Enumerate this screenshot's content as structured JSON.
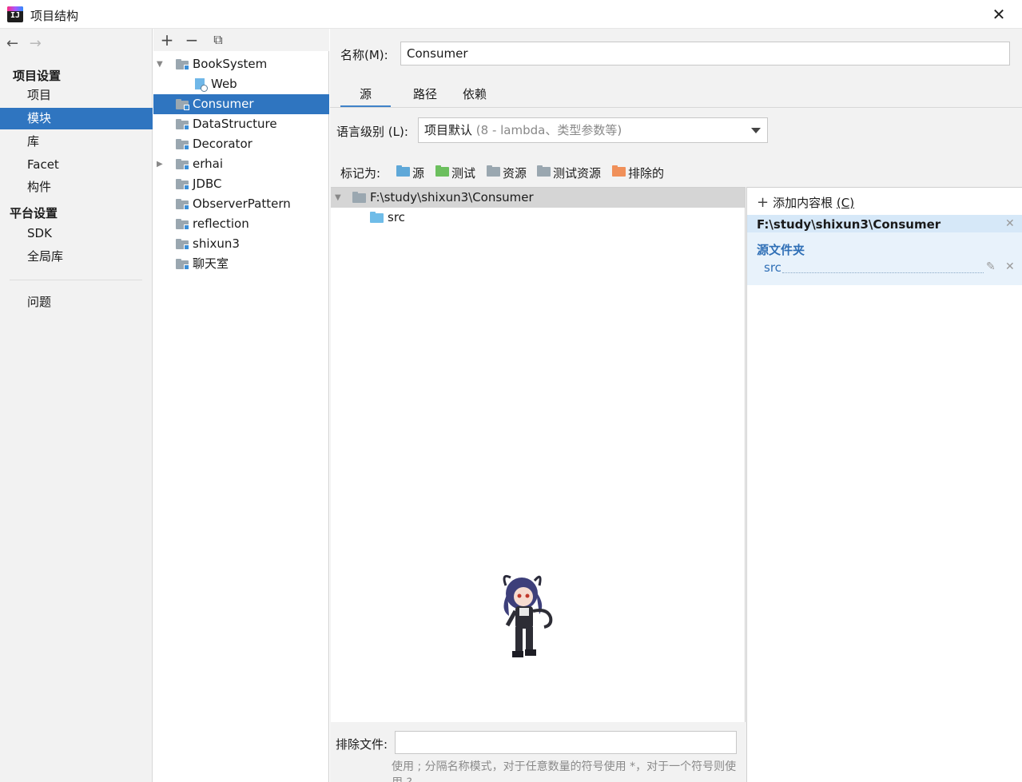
{
  "window": {
    "title": "项目结构",
    "close_glyph": "✕"
  },
  "nav": {
    "back_glyph": "←",
    "forward_glyph": "→",
    "project_settings_heading": "项目设置",
    "project_settings_items": [
      "项目",
      "模块",
      "库",
      "Facet",
      "构件"
    ],
    "platform_settings_heading": "平台设置",
    "platform_settings_items": [
      "SDK",
      "全局库"
    ],
    "problems": "问题",
    "selected": "模块"
  },
  "module_tree": {
    "toolbar": {
      "add_glyph": "+",
      "remove_glyph": "−",
      "copy_glyph": "⧉"
    },
    "items": [
      {
        "label": "BookSystem",
        "expanded": true
      },
      {
        "label": "Web",
        "child": true
      },
      {
        "label": "Consumer",
        "selected": true
      },
      {
        "label": "DataStructure"
      },
      {
        "label": "Decorator"
      },
      {
        "label": "erhai",
        "collapsed": true
      },
      {
        "label": "JDBC"
      },
      {
        "label": "ObserverPattern"
      },
      {
        "label": "reflection"
      },
      {
        "label": "shixun3"
      },
      {
        "label": "聊天室"
      }
    ]
  },
  "module": {
    "name_label": "名称(M):",
    "name_value": "Consumer",
    "tabs": [
      "源",
      "路径",
      "依赖"
    ],
    "active_tab": "源",
    "language_level_label": "语言级别 (L):",
    "language_level_value": "项目默认",
    "language_level_detail": "(8 - lambda、类型参数等)",
    "mark_as_label": "标记为:",
    "mark_buttons": [
      {
        "label": "源",
        "color": "#5fa8d8"
      },
      {
        "label": "测试",
        "color": "#6cbf5e"
      },
      {
        "label": "资源",
        "color": "#9aa7b0"
      },
      {
        "label": "测试资源",
        "color": "#9aa7b0"
      },
      {
        "label": "排除的",
        "color": "#f0905a"
      }
    ],
    "source_tree": {
      "root": "F:\\study\\shixun3\\Consumer",
      "children": [
        "src"
      ]
    },
    "content_root_panel": {
      "add_root": "添加内容根",
      "add_root_shortcut": "(C)",
      "root_path": "F:\\study\\shixun3\\Consumer",
      "source_folders_heading": "源文件夹",
      "source_folders": [
        "src"
      ]
    },
    "exclude_files_label": "排除文件:",
    "exclude_files_value": "",
    "exclude_help": "使用 ; 分隔名称模式，对于任意数量的符号使用 *，对于一个符号则使用 ?"
  },
  "colors": {
    "selection": "#2f75c0",
    "panel_bg": "#f2f2f2",
    "link_blue": "#2f6fb6"
  }
}
